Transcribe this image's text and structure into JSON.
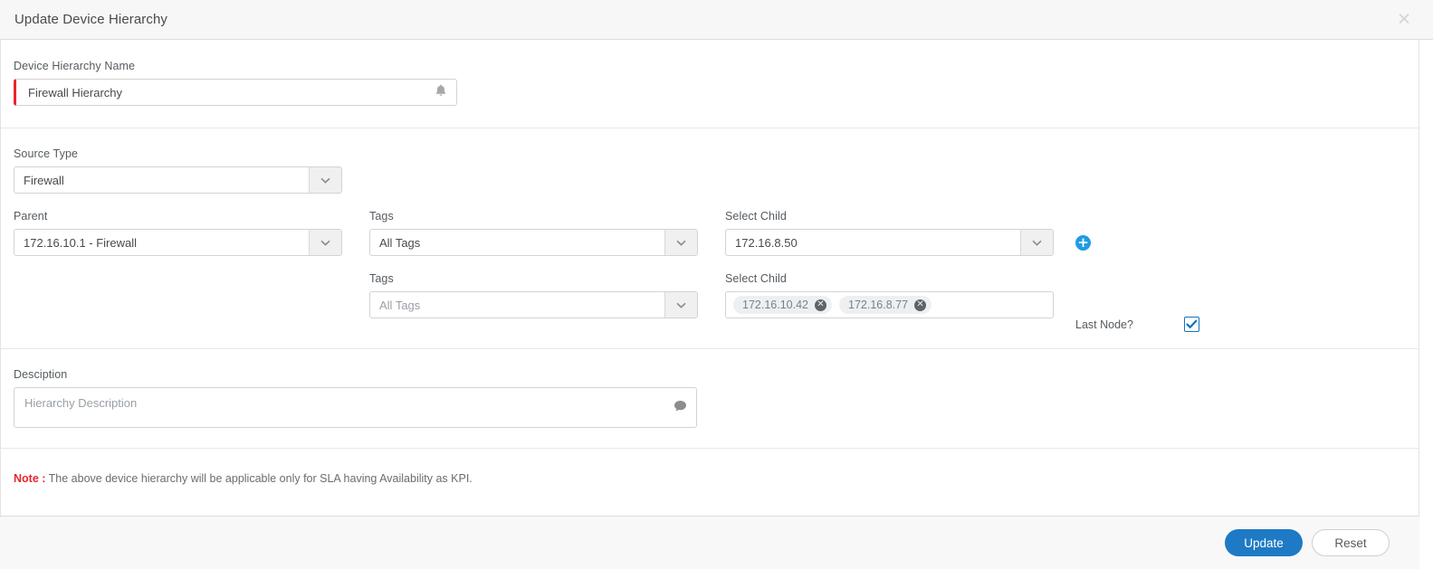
{
  "header": {
    "title": "Update Device Hierarchy",
    "close_label": "✕"
  },
  "form": {
    "hierarchy_name": {
      "label": "Device Hierarchy Name",
      "value": "Firewall Hierarchy",
      "icon": "bell-icon",
      "required_marker_color": "#e8262a"
    },
    "source_type": {
      "label": "Source Type",
      "value": "Firewall"
    },
    "rows": [
      {
        "parent_label": "Parent",
        "parent_value": "172.16.10.1 - Firewall",
        "tags_label": "Tags",
        "tags_value": "All Tags",
        "tags_is_placeholder": false,
        "child_label": "Select Child",
        "child_value": "172.16.8.50",
        "child_is_chips": false,
        "add_button_label": "+"
      },
      {
        "tags_label": "Tags",
        "tags_value": "All Tags",
        "tags_is_placeholder": true,
        "child_label": "Select Child",
        "child_is_chips": true,
        "child_chips": [
          "172.16.10.42",
          "172.16.8.77"
        ],
        "chip_remove_label": "✕",
        "last_node_label": "Last Node?",
        "last_node_checked": true
      }
    ],
    "description": {
      "label": "Desciption",
      "value": "",
      "placeholder": "Hierarchy Description",
      "icon": "comment-icon"
    }
  },
  "note": {
    "prefix": "Note :",
    "text": "The above device hierarchy will be applicable only for SLA having Availability as KPI."
  },
  "footer": {
    "update_label": "Update",
    "reset_label": "Reset"
  },
  "colors": {
    "accent": "#1e7ac4",
    "add_icon": "#1f9ce4",
    "danger": "#e8262a",
    "header_bg": "#f7f7f7",
    "footer_bg": "#f8f8f8"
  }
}
